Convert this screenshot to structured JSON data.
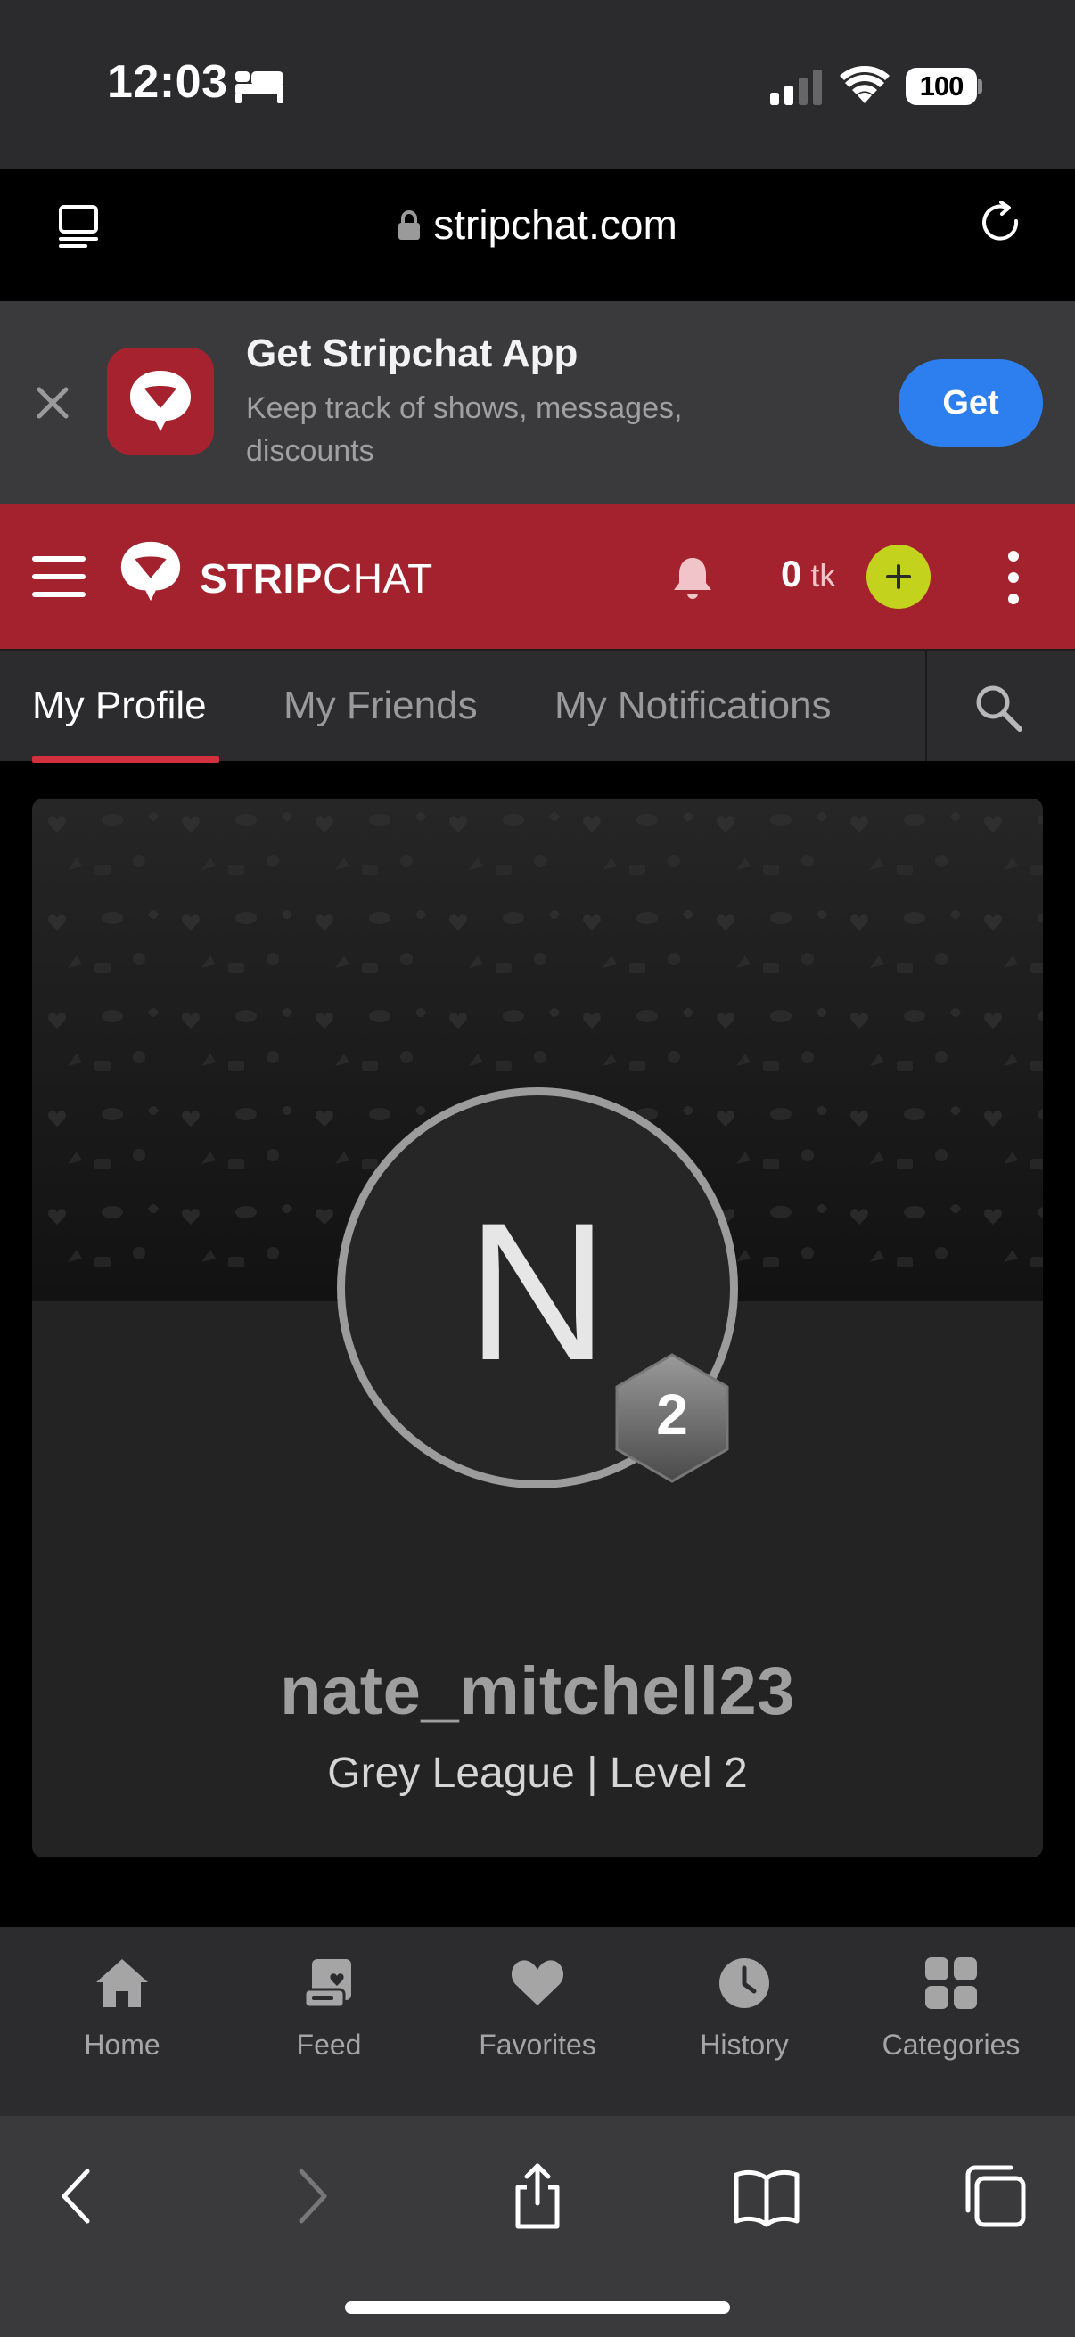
{
  "status_bar": {
    "time": "12:03",
    "icons": [
      "sleep-focus-icon",
      "cellular-signal-icon",
      "wifi-icon",
      "battery-icon"
    ],
    "battery_percent": "100"
  },
  "browser": {
    "url": "stripchat.com",
    "icons": [
      "reader-mode-icon",
      "lock-icon",
      "reload-icon"
    ]
  },
  "app_banner": {
    "title": "Get Stripchat App",
    "subtitle": "Keep track of shows, messages, discounts",
    "button_label": "Get",
    "accent_color": "#2d7ff0"
  },
  "header": {
    "logo_bold": "STRIP",
    "logo_light": "CHAT",
    "token_count": "0",
    "token_unit": "tk",
    "brand_color": "#a3222e",
    "buy_button_color": "#c3d21d"
  },
  "tabs": {
    "items": [
      {
        "label": "My Profile",
        "active": true
      },
      {
        "label": "My Friends",
        "active": false
      },
      {
        "label": "My Notifications",
        "active": false
      }
    ],
    "active_color": "#d2303c"
  },
  "profile": {
    "avatar_letter": "N",
    "level_badge": "2",
    "username": "nate_mitchell23",
    "league_text": "Grey League | Level 2"
  },
  "site_nav": {
    "items": [
      {
        "label": "Home",
        "icon": "home-icon"
      },
      {
        "label": "Feed",
        "icon": "feed-icon"
      },
      {
        "label": "Favorites",
        "icon": "heart-icon"
      },
      {
        "label": "History",
        "icon": "clock-icon"
      },
      {
        "label": "Categories",
        "icon": "grid-icon"
      }
    ]
  },
  "safari_toolbar": {
    "icons": [
      "back-icon",
      "forward-icon",
      "share-icon",
      "bookmarks-icon",
      "tabs-icon"
    ]
  }
}
